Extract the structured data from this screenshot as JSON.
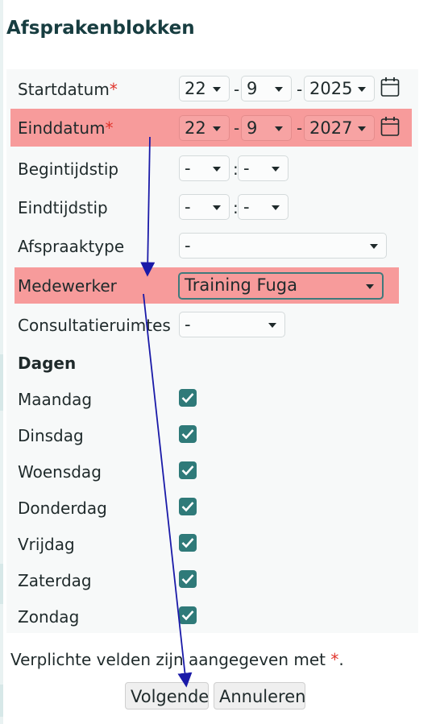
{
  "title": "Afsprakenblokken",
  "form": {
    "startdatum": {
      "label": "Startdatum",
      "required": "*",
      "day": "22",
      "month": "9",
      "year": "2025"
    },
    "einddatum": {
      "label": "Einddatum",
      "required": "*",
      "day": "22",
      "month": "9",
      "year": "2027"
    },
    "begintijdstip": {
      "label": "Begintijdstip",
      "hour": "-",
      "minute": "-"
    },
    "eindtijdstip": {
      "label": "Eindtijdstip",
      "hour": "-",
      "minute": "-"
    },
    "afspraaktype": {
      "label": "Afspraaktype",
      "value": "-"
    },
    "medewerker": {
      "label": "Medewerker",
      "value": "Training Fuga"
    },
    "consultatieruimtes": {
      "label": "Consultatieruimtes",
      "value": "-"
    },
    "separators": {
      "date": "-",
      "time": ":"
    }
  },
  "dagen": {
    "heading": "Dagen",
    "days": [
      {
        "label": "Maandag",
        "checked": true
      },
      {
        "label": "Dinsdag",
        "checked": true
      },
      {
        "label": "Woensdag",
        "checked": true
      },
      {
        "label": "Donderdag",
        "checked": true
      },
      {
        "label": "Vrijdag",
        "checked": true
      },
      {
        "label": "Zaterdag",
        "checked": true
      },
      {
        "label": "Zondag",
        "checked": true
      }
    ]
  },
  "footer": {
    "note": "Verplichte velden zijn aangegeven met ",
    "note_marker": "*",
    "note_end": "."
  },
  "buttons": {
    "next": "Volgende",
    "cancel": "Annuleren"
  },
  "colors": {
    "highlight": "#f79b9b",
    "checkbox": "#2f7a79",
    "required": "#e0342c",
    "arrow": "#1a1aa8"
  },
  "icons": [
    "calendar-icon",
    "chevron-down-icon",
    "checkmark-icon"
  ]
}
